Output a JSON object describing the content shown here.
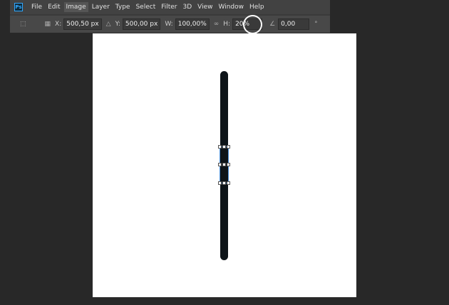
{
  "menu": {
    "logo": "Ps",
    "items": [
      "File",
      "Edit",
      "Image",
      "Layer",
      "Type",
      "Select",
      "Filter",
      "3D",
      "View",
      "Window",
      "Help"
    ],
    "active": "Image"
  },
  "options": {
    "x_label": "X:",
    "x_value": "500,50 px",
    "y_label": "Y:",
    "y_value": "500,00 px",
    "w_label": "W:",
    "w_value": "100,00%",
    "h_label": "H:",
    "h_value": "20%",
    "angle_value": "0,00",
    "degree": "°"
  },
  "colors": {
    "accent": "#31a8ff",
    "shape": "#0d1418"
  }
}
